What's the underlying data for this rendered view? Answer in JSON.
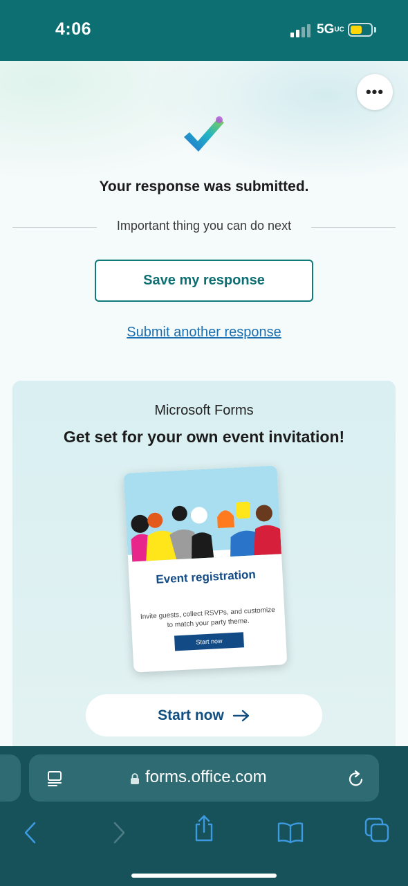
{
  "status_bar": {
    "time": "4:06",
    "network": "5G",
    "network_suffix": "UC",
    "battery_color": "#ffd60a"
  },
  "page": {
    "more_label": "•••",
    "success_icon": "checkmark-icon",
    "title": "Your response was submitted.",
    "divider_text": "Important thing you can do next",
    "save_button": "Save my response",
    "submit_another_link": "Submit another response"
  },
  "promo": {
    "eyebrow": "Microsoft Forms",
    "headline": "Get set for your own event invitation!",
    "card": {
      "title": "Event registration",
      "description": "Invite guests, collect RSVPs, and customize to match your party theme.",
      "button": "Start now"
    },
    "start_button": "Start now"
  },
  "browser": {
    "url": "forms.office.com",
    "theme_color": "#17515a",
    "icons": [
      "reader-icon",
      "lock-icon",
      "reload-icon",
      "back-icon",
      "forward-icon",
      "share-icon",
      "bookmarks-icon",
      "tabs-icon"
    ]
  },
  "colors": {
    "header_teal": "#0e6f73",
    "accent_teal": "#0e7a7a",
    "link_blue": "#1a6fb0",
    "promo_blue": "#114d7e"
  }
}
